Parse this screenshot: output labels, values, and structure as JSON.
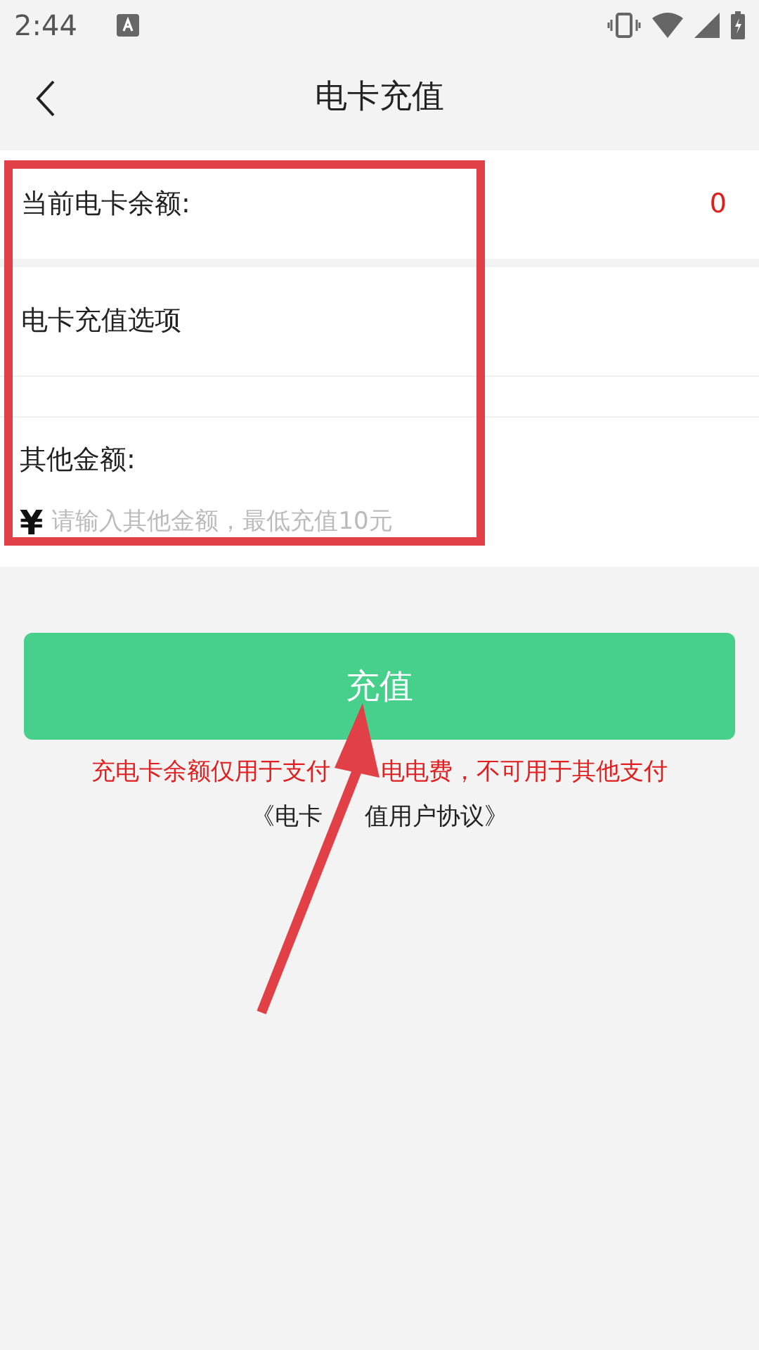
{
  "status_bar": {
    "time": "2:44"
  },
  "header": {
    "title": "电卡充值"
  },
  "balance": {
    "label": "当前电卡余额:",
    "value": "0"
  },
  "options": {
    "label": "电卡充值选项"
  },
  "other_amount": {
    "label": "其他金额:",
    "currency": "¥",
    "placeholder": "请输入其他金额，最低充值10元"
  },
  "submit_button": {
    "label": "充值"
  },
  "notice_parts": [
    "充电卡余额仅用于支付",
    "电电费，不可用于其他支付"
  ],
  "agreement_link_parts": [
    "《电卡",
    "值用户协议》"
  ]
}
